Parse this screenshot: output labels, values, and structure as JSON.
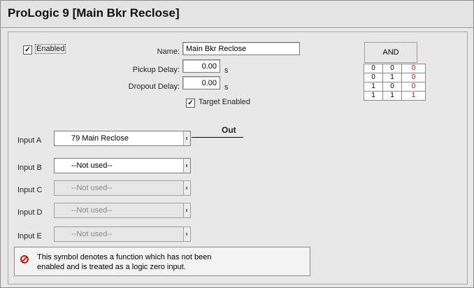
{
  "window": {
    "title": "ProLogic 9 [Main Bkr Reclose]"
  },
  "settings": {
    "enabled": {
      "label": "Enabled",
      "checked": true
    },
    "name": {
      "label": "Name:",
      "value": "Main Bkr Reclose"
    },
    "pickup_delay": {
      "label": "Pickup Delay:",
      "value": "0.00",
      "unit": "s"
    },
    "dropout_delay": {
      "label": "Dropout Delay:",
      "value": "0.00",
      "unit": "s"
    },
    "target_enabled": {
      "label": "Target Enabled",
      "checked": true
    }
  },
  "truth_table": {
    "gate": "AND",
    "rows": [
      [
        "0",
        "0",
        "0"
      ],
      [
        "0",
        "1",
        "0"
      ],
      [
        "1",
        "0",
        "0"
      ],
      [
        "1",
        "1",
        "1"
      ]
    ],
    "output_color": "#e00000"
  },
  "out_label": "Out",
  "inputs": [
    {
      "label": "Input A",
      "value": "79 Main Reclose",
      "enabled": true
    },
    {
      "label": "Input B",
      "value": "--Not used--",
      "enabled": true
    },
    {
      "label": "Input C",
      "value": "--Not used--",
      "enabled": false
    },
    {
      "label": "Input D",
      "value": "--Not used--",
      "enabled": false
    },
    {
      "label": "Input E",
      "value": "--Not used--",
      "enabled": false
    }
  ],
  "note": {
    "icon": "no-entry-icon",
    "text_line1": "This symbol denotes a function which has not been",
    "text_line2": "enabled and is treated as a logic zero input."
  }
}
